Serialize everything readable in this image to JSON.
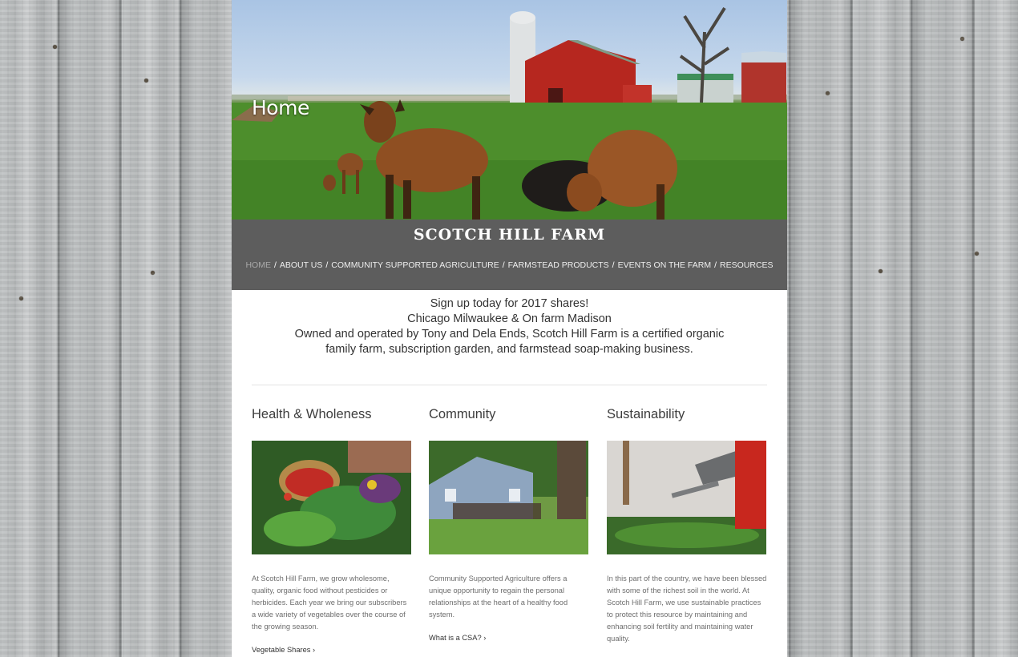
{
  "hero": {
    "title": "Home"
  },
  "site": {
    "name": "SCOTCH HILL FARM"
  },
  "nav": {
    "items": [
      {
        "label": "HOME"
      },
      {
        "label": "ABOUT US"
      },
      {
        "label": "COMMUNITY SUPPORTED AGRICULTURE"
      },
      {
        "label": "FARMSTEAD PRODUCTS"
      },
      {
        "label": "EVENTS ON THE FARM"
      },
      {
        "label": "RESOURCES"
      }
    ],
    "separator": "/",
    "active_color": "#a9a9a9"
  },
  "intro": {
    "signup": "Sign up today for 2017 shares!",
    "locations": "Chicago  Milwaukee & On farm  Madison",
    "owned_line1": "Owned and operated by Tony and Dela Ends, Scotch Hill Farm is a certified organic",
    "owned_line2": "family farm, subscription garden, and farmstead soap-making business."
  },
  "columns": [
    {
      "heading": "Health & Wholeness",
      "text": "At Scotch Hill Farm, we grow wholesome, quality, organic food  without pesticides or herbicides. Each year we bring our subscribers a wide variety of vegetables over the course of the growing season.",
      "link": "Vegetable Shares ›"
    },
    {
      "heading": "Community",
      "text": "Community Supported Agriculture offers a unique opportunity to regain the personal relationships at the heart of a healthy food system.",
      "link": "What is a CSA? ›"
    },
    {
      "heading": "Sustainability",
      "text": "In this part of the country, we have been blessed with some of the richest soil in the world. At Scotch Hill Farm, we use sustainable practices to protect this resource by maintaining and enhancing soil fertility and maintaining water quality."
    }
  ],
  "colors": {
    "band": "#5d5d5d",
    "brand": "#ffffff",
    "background_wood": "#b9bcbd"
  }
}
